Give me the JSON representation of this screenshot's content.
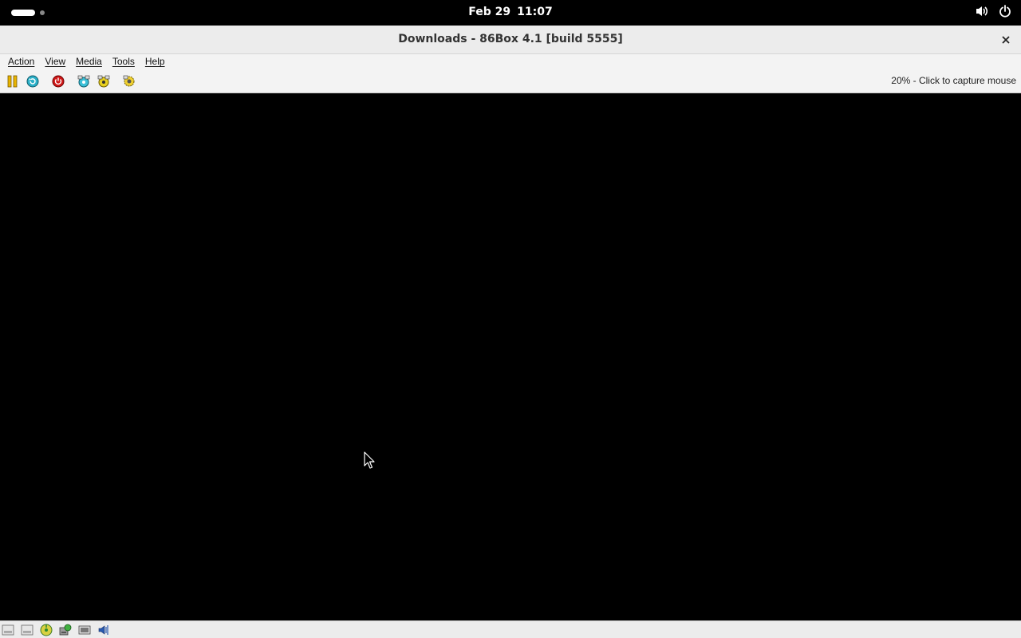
{
  "topbar": {
    "date": "Feb 29",
    "time": "11:07"
  },
  "window": {
    "title": "Downloads - 86Box 4.1 [build 5555]"
  },
  "menu": {
    "items": [
      "Action",
      "View",
      "Media",
      "Tools",
      "Help"
    ]
  },
  "toolbar": {
    "buttons": [
      "pause-icon",
      "reset-icon",
      "power-icon",
      "ctrl-alt-del-icon",
      "ctrl-alt-esc-icon",
      "settings-icon"
    ],
    "capture_hint": "20% - Click to capture mouse"
  },
  "statusbar": {
    "icons": [
      "floppy-drive-1-icon",
      "floppy-drive-2-icon",
      "cdrom-icon",
      "hard-disk-icon",
      "keyboard-icon",
      "sound-icon"
    ]
  },
  "colors": {
    "topbar_bg": "#000000",
    "window_bg": "#ececec",
    "screen_bg": "#000000"
  }
}
